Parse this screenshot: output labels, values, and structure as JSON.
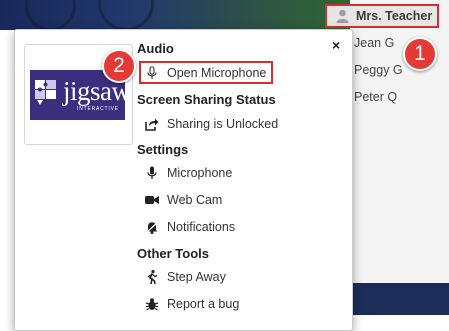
{
  "participants": {
    "host": "Mrs. Teacher",
    "list": [
      "Jean G",
      "Peggy G",
      "Peter Q"
    ]
  },
  "menu": {
    "logo_text": "jigsaw",
    "logo_subtext": "INTERACTIVE",
    "close_icon": "×",
    "sections": {
      "audio": {
        "title": "Audio",
        "open_microphone": "Open Microphone"
      },
      "screen_sharing": {
        "title": "Screen Sharing Status",
        "status": "Sharing is Unlocked"
      },
      "settings": {
        "title": "Settings",
        "microphone": "Microphone",
        "web_cam": "Web Cam",
        "notifications": "Notifications"
      },
      "other_tools": {
        "title": "Other Tools",
        "step_away": "Step Away",
        "report_bug": "Report a bug"
      }
    }
  },
  "callouts": {
    "one": "1",
    "two": "2"
  },
  "colors": {
    "highlight": "#d32f2f",
    "badge": "#e53935",
    "logo_bg": "#3c2e7e"
  }
}
